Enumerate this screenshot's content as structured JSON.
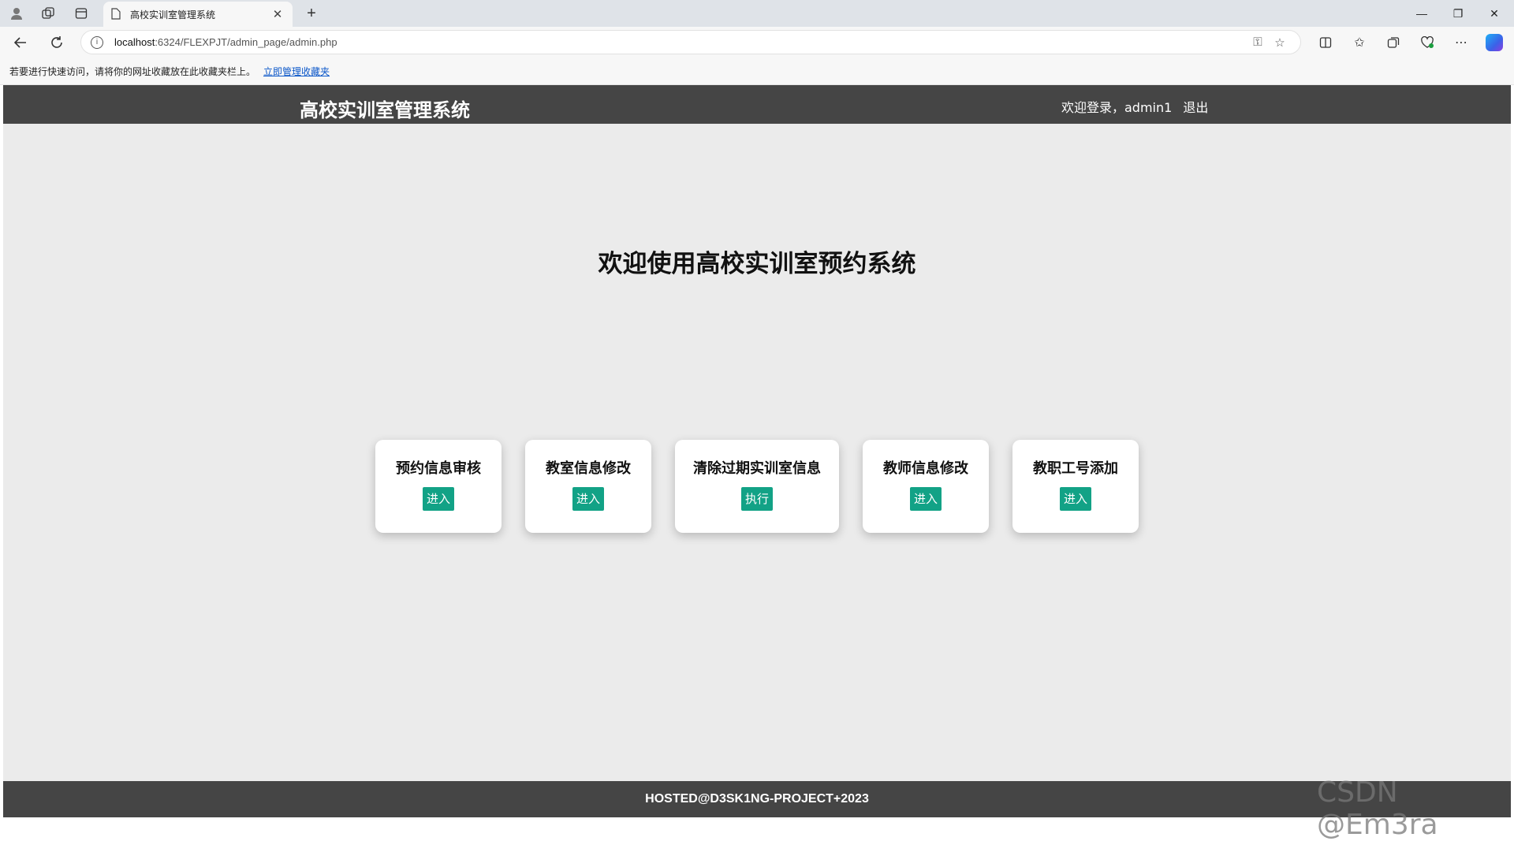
{
  "browser": {
    "tab_title": "高校实训室管理系统",
    "tab_close": "✕",
    "new_tab": "+",
    "address_host": "localhost",
    "address_path": ":6324/FLEXPJT/admin_page/admin.php",
    "favorites_prompt": "若要进行快速访问，请将你的网址收藏放在此收藏夹栏上。",
    "favorites_link": "立即管理收藏夹",
    "window_min": "—",
    "window_restore": "❐",
    "window_close": "✕"
  },
  "site": {
    "title": "高校实训室管理系统",
    "welcome_user": "欢迎登录，admin1",
    "logout": "退出",
    "main_heading": "欢迎使用高校实训室预约系统",
    "footer": "HOSTED@D3SK1NG-PROJECT+2023"
  },
  "cards": [
    {
      "title": "预约信息审核",
      "button": "进入"
    },
    {
      "title": "教室信息修改",
      "button": "进入"
    },
    {
      "title": "清除过期实训室信息",
      "button": "执行"
    },
    {
      "title": "教师信息修改",
      "button": "进入"
    },
    {
      "title": "教职工号添加",
      "button": "进入"
    }
  ],
  "watermark": "CSDN @Em3ra",
  "colors": {
    "header_bg": "#454545",
    "page_bg": "#ebebeb",
    "button_bg": "#12a286",
    "link": "#0b57c9"
  }
}
